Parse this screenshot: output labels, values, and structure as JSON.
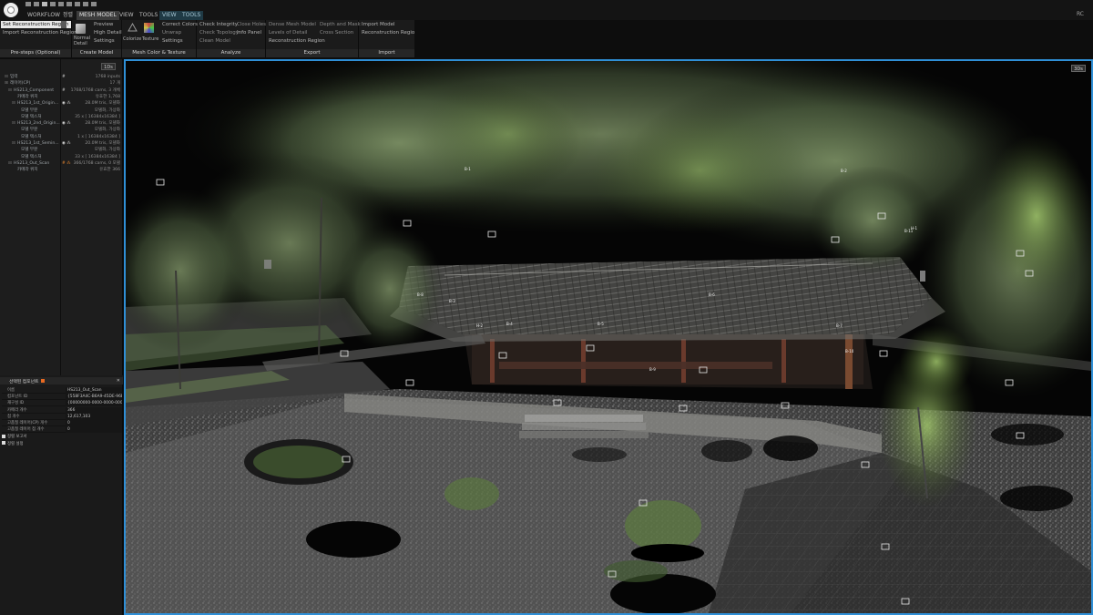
{
  "titlebar": {
    "menu_tabs": [
      "WORKFLOW",
      "정렬",
      "MESH MODEL",
      "VIEW",
      "TOOLS",
      "VIEW",
      "TOOLS"
    ],
    "corner_label": "RC"
  },
  "ribbon": {
    "prestep": {
      "items": [
        "Set Reconstruction Region",
        "Import Reconstruction Region"
      ],
      "footer": "Pre-steps (Optional)"
    },
    "create_model": {
      "items": [
        "Preview",
        "High Detail",
        "Settings"
      ],
      "normal_detail_label": "Normal\nDetail",
      "footer": "Create Model"
    },
    "color_texture": {
      "colorize_label": "Colorize",
      "texture_label": "Texture",
      "items": [
        "Correct Colors",
        "Unwrap",
        "Settings"
      ],
      "footer": "Mesh Color & Texture"
    },
    "analyze": {
      "col1": [
        "Check Integrity",
        "Check Topology",
        "Clean Model"
      ],
      "col2": [
        "Close Holes",
        "Info Panel"
      ],
      "footer": "Analyze"
    },
    "export": {
      "col1": [
        "Dense Mesh Model",
        "Levels of Detail",
        "Reconstruction Region"
      ],
      "col2": [
        "Depth and Mask",
        "Cross Section"
      ],
      "footer": "Export"
    },
    "import": {
      "items": [
        "Import Model",
        "Reconstruction Region"
      ],
      "footer": "Import"
    }
  },
  "tree_panel": {
    "view_tab": "1Ds",
    "rows": [
      {
        "name": "입력",
        "value": "1768 inputs",
        "indent": 0,
        "mark": "#"
      },
      {
        "name": "레이어(CP)",
        "value": "17 개",
        "indent": 0,
        "mark": ""
      },
      {
        "name": "HS213_Component",
        "value": "1768/1768 cams, 3 개체",
        "indent": 1,
        "mark": "#"
      },
      {
        "name": "카메라 위치",
        "value": "유효한 1,768",
        "indent": 2,
        "mark": ""
      },
      {
        "name": "HS213_1st_Origin...",
        "value": "28.0M tris, 모델화",
        "indent": 2,
        "mark": "◉ ⁂"
      },
      {
        "name": "모델 부분",
        "value": "모델화, 가상화",
        "indent": 3,
        "mark": ""
      },
      {
        "name": "모델 텍스처",
        "value": "35 x [ 16384x16384 ]",
        "indent": 3,
        "mark": ""
      },
      {
        "name": "HS213_2nd_Origin...",
        "value": "28.0M tris, 모델화",
        "indent": 2,
        "mark": "◉ ⁂"
      },
      {
        "name": "모델 부분",
        "value": "모델화, 가상화",
        "indent": 3,
        "mark": ""
      },
      {
        "name": "모델 텍스처",
        "value": "1 x [ 16384x16384 ]",
        "indent": 3,
        "mark": ""
      },
      {
        "name": "HS213_1st_Semin...",
        "value": "20.0M tris, 모델화",
        "indent": 2,
        "mark": "◉ ⁂"
      },
      {
        "name": "모델 부분",
        "value": "모델화, 가상화",
        "indent": 3,
        "mark": ""
      },
      {
        "name": "모델 텍스처",
        "value": "33 x [ 16384x16384 ]",
        "indent": 3,
        "mark": ""
      },
      {
        "name": "HS213_Out_Scan",
        "value": "366/1768 cams, 0 모델",
        "indent": 1,
        "mark": "# ⁂",
        "flag": true
      },
      {
        "name": "카메라 위치",
        "value": "유효한 366",
        "indent": 2,
        "mark": ""
      }
    ]
  },
  "props_panel": {
    "title": "선택된 컴포넌트",
    "rows": [
      {
        "key": "이름",
        "value": "HS213_Out_Scan"
      },
      {
        "key": "컴포넌트 ID",
        "value": "{558F3A4C-B6A9-45DE-96B..."
      },
      {
        "key": "재구성 ID",
        "value": "{00000000-0000-0000-000..."
      },
      {
        "key": "카메라 개수",
        "value": "366"
      },
      {
        "key": "점 개수",
        "value": "12,617,103"
      },
      {
        "key": "고품질 레이어(CP) 개수",
        "value": "0"
      },
      {
        "key": "고품질 레이어 점 개수",
        "value": "0"
      }
    ],
    "checks": [
      "정렬 보고서",
      "정렬 설정"
    ]
  },
  "viewport": {
    "view_tab": "3Ds",
    "camera_labels": [
      "B-1",
      "B-2",
      "B-3",
      "B-4",
      "B-5",
      "B-6",
      "B-7",
      "B-8",
      "B-9",
      "B-10",
      "B-11",
      "H-1",
      "H-2"
    ]
  },
  "colors": {
    "accent_blue": "#2f8fd6",
    "warning_orange": "#e86a22",
    "ribbon_bg": "#1b1b1b",
    "foliage_green": "#6f8a55"
  }
}
